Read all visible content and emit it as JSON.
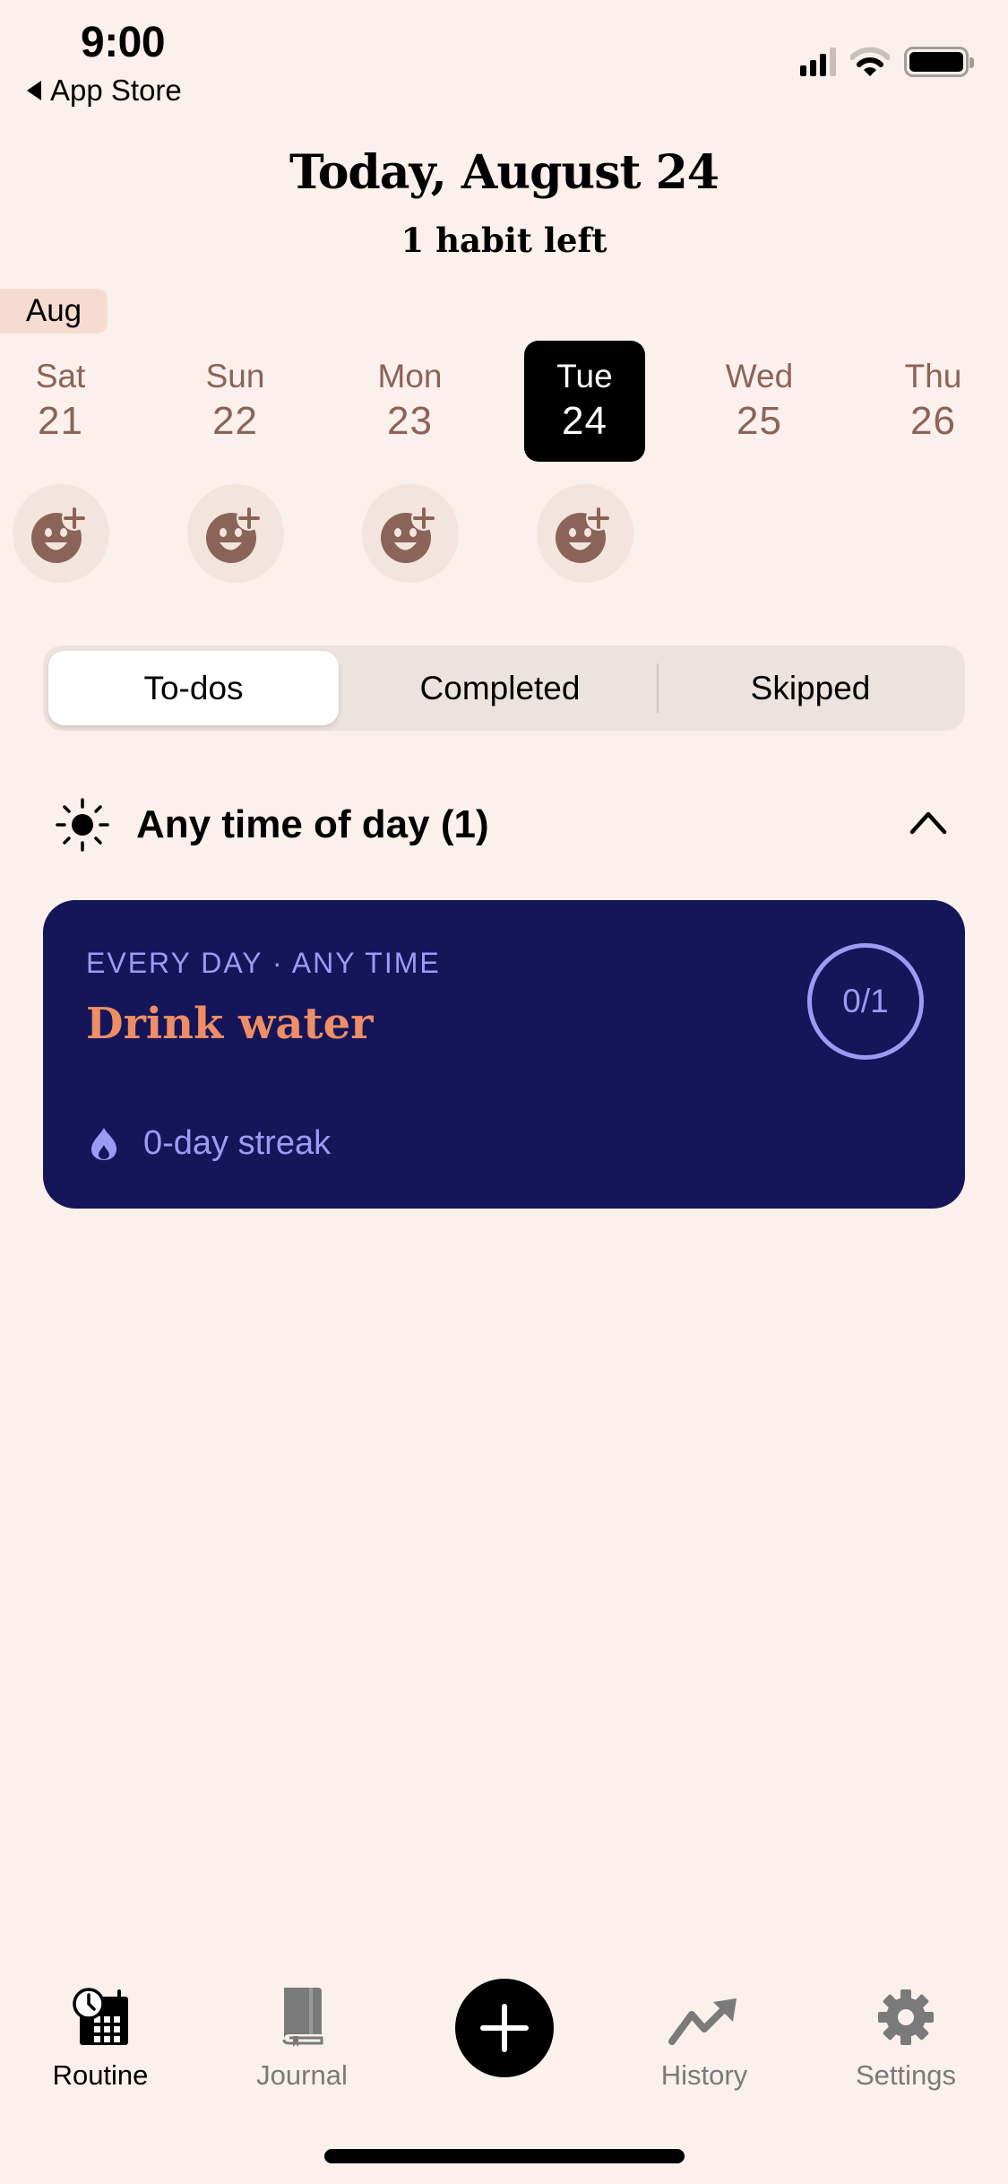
{
  "status_bar": {
    "time": "9:00",
    "back_label": "App Store"
  },
  "header": {
    "title": "Today, August 24",
    "subtitle": "1 habit left"
  },
  "calendar": {
    "month": "Aug",
    "days": [
      {
        "dow": "Sat",
        "num": "21",
        "selected": false,
        "has_mood": true
      },
      {
        "dow": "Sun",
        "num": "22",
        "selected": false,
        "has_mood": true
      },
      {
        "dow": "Mon",
        "num": "23",
        "selected": false,
        "has_mood": true
      },
      {
        "dow": "Tue",
        "num": "24",
        "selected": true,
        "has_mood": true
      },
      {
        "dow": "Wed",
        "num": "25",
        "selected": false,
        "has_mood": false
      },
      {
        "dow": "Thu",
        "num": "26",
        "selected": false,
        "has_mood": false
      }
    ]
  },
  "segments": {
    "items": [
      "To-dos",
      "Completed",
      "Skipped"
    ],
    "selected": "To-dos"
  },
  "section": {
    "icon": "sun-icon",
    "label": "Any time of day (1)"
  },
  "habit": {
    "schedule": "EVERY DAY · ANY TIME",
    "name": "Drink water",
    "progress": "0/1",
    "streak": "0-day streak"
  },
  "colors": {
    "background": "#FBF0EB",
    "card": "#15155A",
    "card_accent": "#9A9CF3",
    "habit_name": "#EE8E66",
    "day_text": "#8A6458"
  },
  "tab_bar": {
    "items": [
      {
        "label": "Routine",
        "icon": "calendar-clock-icon",
        "active": true
      },
      {
        "label": "Journal",
        "icon": "journal-icon",
        "active": false
      },
      {
        "label": "History",
        "icon": "trend-up-icon",
        "active": false
      },
      {
        "label": "Settings",
        "icon": "gear-icon",
        "active": false
      }
    ],
    "add_icon": "plus-icon"
  }
}
